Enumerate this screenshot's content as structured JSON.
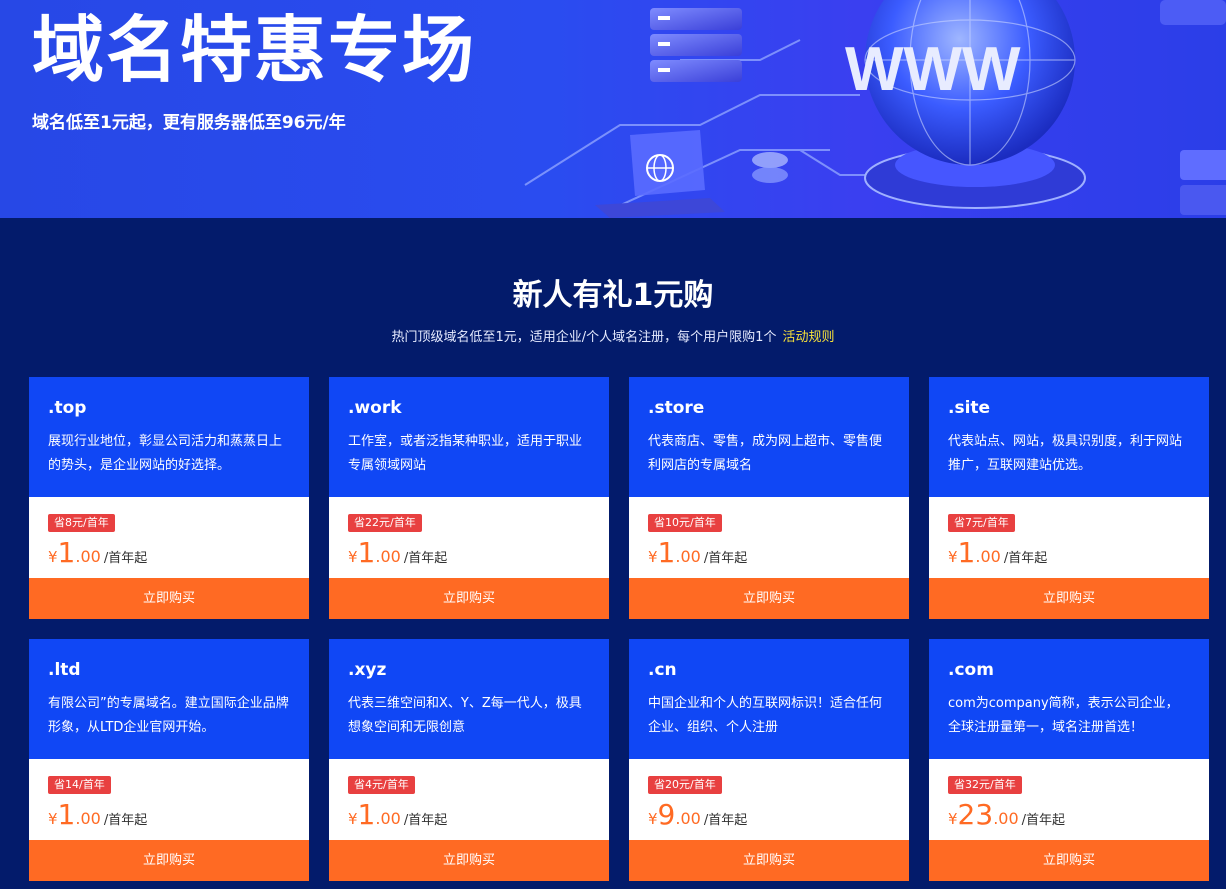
{
  "banner": {
    "title": "域名特惠专场",
    "subtitle": "域名低至1元起，更有服务器低至96元/年",
    "illustration_text": "WWW"
  },
  "section": {
    "title": "新人有礼1元购",
    "desc": "热门顶级域名低至1元，适用企业/个人域名注册，每个用户限购1个",
    "rules_link": "活动规则"
  },
  "colors": {
    "page_bg": "#031b6b",
    "card_top": "#1047f5",
    "accent_orange": "#ff6a23",
    "badge_red": "#e84040",
    "link_yellow": "#f6e03a"
  },
  "cards": [
    {
      "name": ".top",
      "desc": "展现行业地位，彰显公司活力和蒸蒸日上的势头，是企业网站的好选择。",
      "save": "省8元/首年",
      "yen": "¥",
      "price_int": "1",
      "price_dec": ".00",
      "unit": "/首年起",
      "buy": "立即购买"
    },
    {
      "name": ".work",
      "desc": "工作室，或者泛指某种职业，适用于职业专属领域网站",
      "save": "省22元/首年",
      "yen": "¥",
      "price_int": "1",
      "price_dec": ".00",
      "unit": "/首年起",
      "buy": "立即购买"
    },
    {
      "name": ".store",
      "desc": "代表商店、零售，成为网上超市、零售便利网店的专属域名",
      "save": "省10元/首年",
      "yen": "¥",
      "price_int": "1",
      "price_dec": ".00",
      "unit": "/首年起",
      "buy": "立即购买"
    },
    {
      "name": ".site",
      "desc": "代表站点、网站，极具识别度，利于网站推广，互联网建站优选。",
      "save": "省7元/首年",
      "yen": "¥",
      "price_int": "1",
      "price_dec": ".00",
      "unit": "/首年起",
      "buy": "立即购买"
    },
    {
      "name": ".ltd",
      "desc": "有限公司”的专属域名。建立国际企业品牌形象，从LTD企业官网开始。",
      "save": "省14/首年",
      "yen": "¥",
      "price_int": "1",
      "price_dec": ".00",
      "unit": "/首年起",
      "buy": "立即购买"
    },
    {
      "name": ".xyz",
      "desc": "代表三维空间和X、Y、Z每一代人，极具想象空间和无限创意",
      "save": "省4元/首年",
      "yen": "¥",
      "price_int": "1",
      "price_dec": ".00",
      "unit": "/首年起",
      "buy": "立即购买"
    },
    {
      "name": ".cn",
      "desc": "中国企业和个人的互联网标识！适合任何企业、组织、个人注册",
      "save": "省20元/首年",
      "yen": "¥",
      "price_int": "9",
      "price_dec": ".00",
      "unit": "/首年起",
      "buy": "立即购买"
    },
    {
      "name": ".com",
      "desc": "com为company简称，表示公司企业，全球注册量第一，域名注册首选！",
      "save": "省32元/首年",
      "yen": "¥",
      "price_int": "23",
      "price_dec": ".00",
      "unit": "/首年起",
      "buy": "立即购买"
    }
  ]
}
